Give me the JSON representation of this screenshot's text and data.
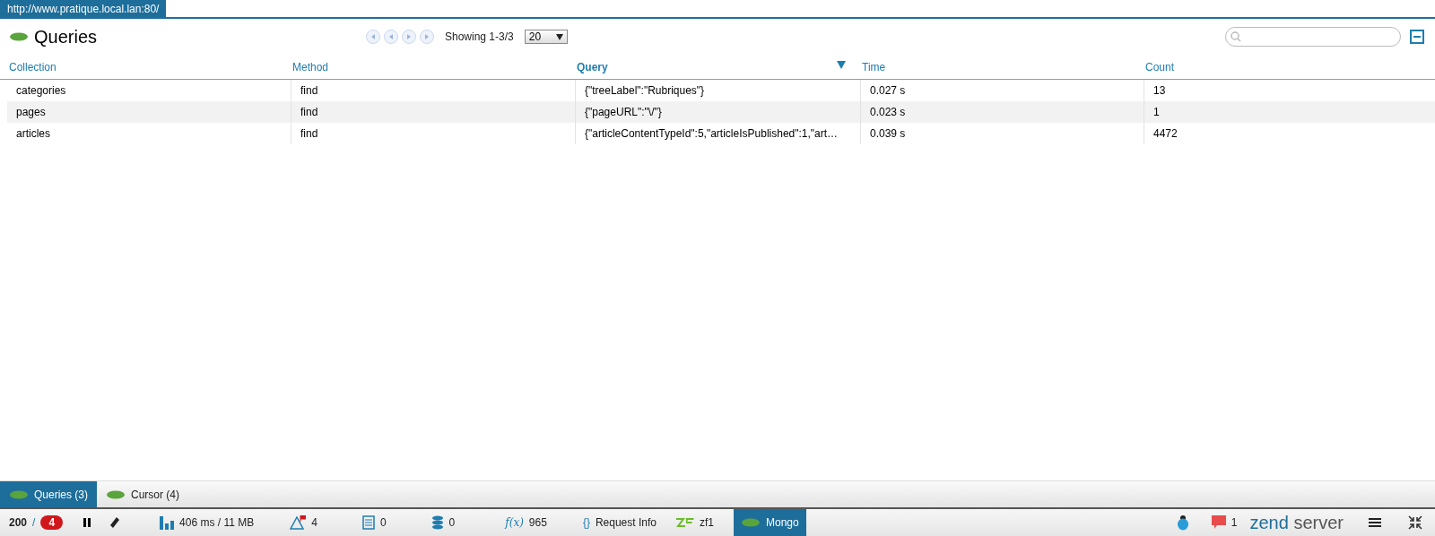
{
  "url": "http://www.pratique.local.lan:80/",
  "panel": {
    "title": "Queries",
    "showing": "Showing 1-3/3",
    "page_size": "20"
  },
  "table": {
    "columns": [
      {
        "label": "Collection",
        "sorted": false
      },
      {
        "label": "Method",
        "sorted": false
      },
      {
        "label": "Query",
        "sorted": true
      },
      {
        "label": "Time",
        "sorted": false
      },
      {
        "label": "Count",
        "sorted": false
      }
    ],
    "rows": [
      [
        "categories",
        "find",
        "{\"treeLabel\":\"Rubriques\"}",
        "0.027 s",
        "13"
      ],
      [
        "pages",
        "find",
        "{\"pageURL\":\"\\/\"}",
        "0.023 s",
        "1"
      ],
      [
        "articles",
        "find",
        "{\"articleContentTypeId\":5,\"articleIsPublished\":1,\"art…",
        "0.039 s",
        "4472"
      ]
    ]
  },
  "tabs": [
    {
      "label": "Queries (3)",
      "selected": true
    },
    {
      "label": "Cursor (4)",
      "selected": false
    }
  ],
  "status_bar": {
    "code": "200",
    "separator": "/",
    "errors": "4",
    "perf": "406 ms / 11 MB",
    "warnings": "4",
    "logs": "0",
    "db": "0",
    "fx": "f(x)",
    "functions": "965",
    "braces": "{}",
    "request_info": "Request Info",
    "framework": "zf1",
    "extensions": [
      {
        "label": "Mongo",
        "selected": true
      }
    ],
    "messages": "1",
    "logo_a": "zend",
    "logo_b": "server"
  }
}
